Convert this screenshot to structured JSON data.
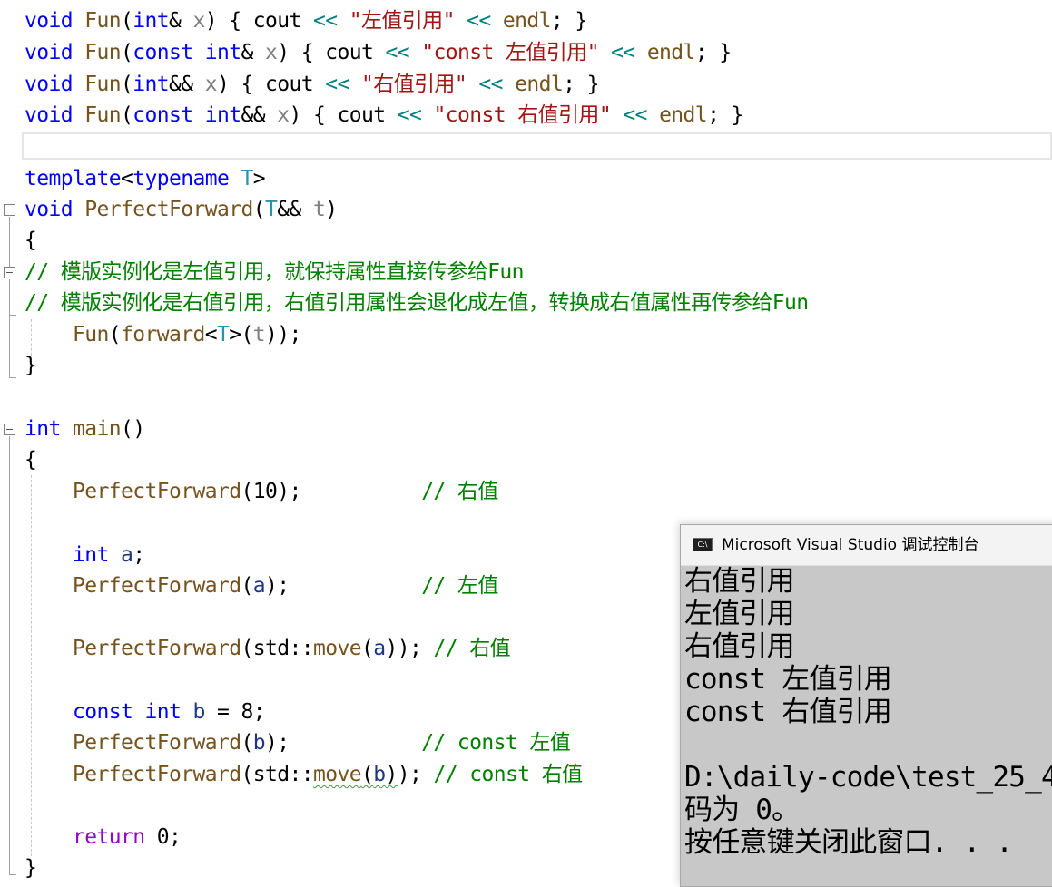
{
  "editor": {
    "lines": [
      "void Fun(int& x) { cout << \"左值引用\" << endl; }",
      "void Fun(const int& x) { cout << \"const 左值引用\" << endl; }",
      "void Fun(int&& x) { cout << \"右值引用\" << endl; }",
      "void Fun(const int&& x) { cout << \"const 右值引用\" << endl; }",
      "",
      "template<typename T>",
      "void PerfectForward(T&& t)",
      "{",
      "// 模版实例化是左值引用，就保持属性直接传参给Fun",
      "// 模版实例化是右值引用，右值引用属性会退化成左值，转换成右值属性再传参给Fun",
      "    Fun(forward<T>(t));",
      "}",
      "",
      "int main()",
      "{",
      "    PerfectForward(10);          // 右值",
      "",
      "    int a;",
      "    PerfectForward(a);           // 左值",
      "",
      "    PerfectForward(std::move(a)); // 右值",
      "",
      "    const int b = 8;",
      "    PerfectForward(b);           // const 左值",
      "    PerfectForward(std::move(b)); // const 右值",
      "",
      "    return 0;",
      "}"
    ],
    "tokens": {
      "void": "void",
      "fun": "Fun",
      "int": "int",
      "const": "const",
      "cout": "cout",
      "endl": "endl",
      "x": "x",
      "shl": "<<",
      "s1": "\"左值引用\"",
      "s2": "\"const 左值引用\"",
      "s3": "\"右值引用\"",
      "s4": "\"const 右值引用\"",
      "template": "template",
      "typename": "typename",
      "T": "T",
      "t": "t",
      "perfect": "PerfectForward",
      "forward": "forward",
      "c1": "// 模版实例化是左值引用，就保持属性直接传参给Fun",
      "c2": "// 模版实例化是右值引用，右值引用属性会退化成左值，转换成右值属性再传参给Fun",
      "main": "main",
      "a": "a",
      "b": "b",
      "std": "std",
      "move": "move",
      "ret": "return",
      "n10": "10",
      "n8": "8",
      "n0": "0",
      "cr": "// 右值",
      "cl": "// 左值",
      "ccl": "// const 左值",
      "ccr": "// const 右值"
    },
    "colors": {
      "keyword": "#0000ff",
      "function": "#74531f",
      "parameter": "#808080",
      "string": "#a31515",
      "comment": "#008000",
      "type_param": "#2b91af",
      "control": "#8f08c4",
      "local": "#1f377f",
      "operator": "#008080"
    }
  },
  "console": {
    "title": "Microsoft Visual Studio 调试控制台",
    "icon": "console-app-icon",
    "icon_text": "C:\\",
    "output": [
      "右值引用",
      "左值引用",
      "右值引用",
      "const 左值引用",
      "const 右值引用",
      "",
      "D:\\daily-code\\test_25_4",
      "码为 0。",
      "按任意键关闭此窗口. . ."
    ],
    "background": "#c8c8c8"
  }
}
